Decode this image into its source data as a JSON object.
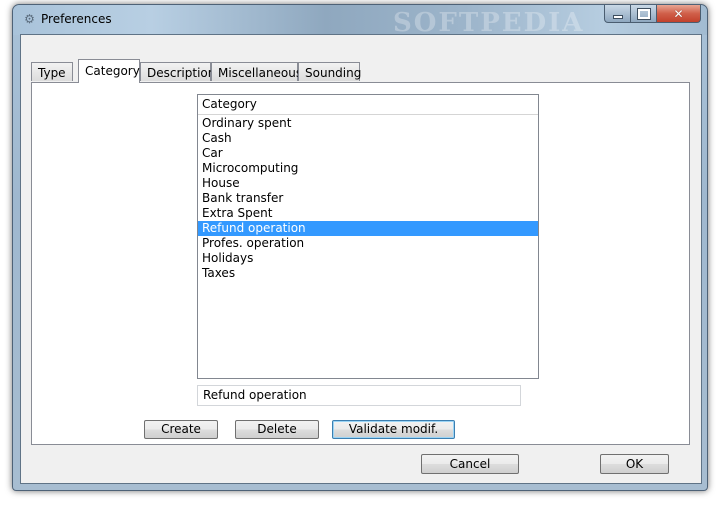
{
  "window": {
    "title": "Preferences",
    "watermark": "SOFTPEDIA"
  },
  "tabs": [
    {
      "label": "Type",
      "active": false
    },
    {
      "label": "Category",
      "active": true
    },
    {
      "label": "Description",
      "active": false
    },
    {
      "label": "Miscellaneous",
      "active": false
    },
    {
      "label": "Sounding",
      "active": false
    }
  ],
  "category_list": {
    "header": "Category",
    "items": [
      "Ordinary spent",
      "Cash",
      "Car",
      "Microcomputing",
      "House",
      "Bank transfer",
      "Extra Spent",
      "Refund operation",
      "Profes. operation",
      "Holidays",
      "Taxes"
    ],
    "selected_index": 7
  },
  "edit": {
    "value": "Refund operation"
  },
  "panel_buttons": {
    "create": "Create",
    "delete": "Delete",
    "validate": "Validate modif."
  },
  "dialog_buttons": {
    "cancel": "Cancel",
    "ok": "OK"
  },
  "colors": {
    "selection": "#3399ff",
    "close_button": "#c2402b"
  }
}
